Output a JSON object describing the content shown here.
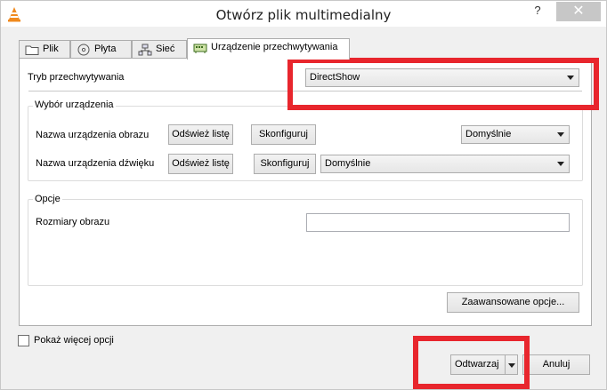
{
  "window": {
    "title": "Otwórz plik multimedialny",
    "help_label": "?",
    "close_label": "✕"
  },
  "tabs": [
    {
      "label": "Plik",
      "icon": "folder-icon"
    },
    {
      "label": "Płyta",
      "icon": "disc-icon"
    },
    {
      "label": "Sieć",
      "icon": "network-icon"
    },
    {
      "label": "Urządzenie przechwytywania",
      "icon": "capture-device-icon",
      "active": true
    }
  ],
  "capture": {
    "mode_label": "Tryb przechwytywania",
    "mode_value": "DirectShow"
  },
  "device_group": {
    "title": "Wybór urządzenia",
    "video_label": "Nazwa urządzenia obrazu",
    "audio_label": "Nazwa urządzenia dźwięku",
    "refresh_label": "Odśwież listę",
    "configure_label": "Skonfiguruj",
    "video_value": "Domyślnie",
    "audio_value": "Domyślnie"
  },
  "options_group": {
    "title": "Opcje",
    "size_label": "Rozmiary obrazu",
    "size_value": "",
    "advanced_label": "Zaawansowane opcje..."
  },
  "footer": {
    "more_options_label": "Pokaż więcej opcji",
    "play_label": "Odtwarzaj",
    "cancel_label": "Anuluj"
  },
  "annotation_color": "#e8262d"
}
